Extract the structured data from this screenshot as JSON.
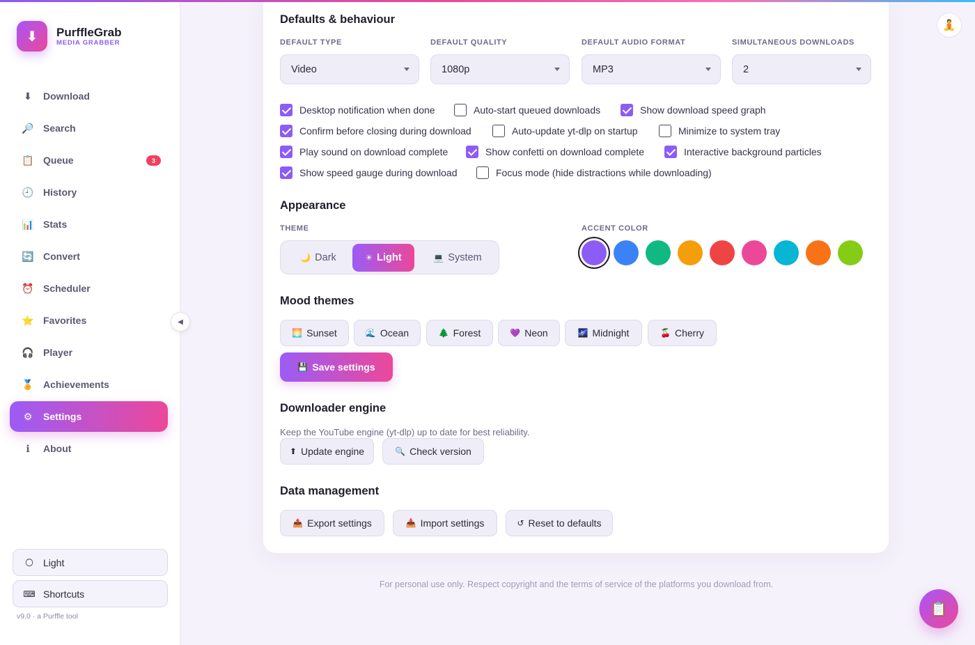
{
  "brand": {
    "name": "PurffleGrab",
    "subtitle": "MEDIA GRABBER",
    "logo_icon": "download-arrow-icon"
  },
  "nav": [
    {
      "label": "Download",
      "icon": "download-icon",
      "glyph": "⬇"
    },
    {
      "label": "Search",
      "icon": "search-icon",
      "glyph": "🔎"
    },
    {
      "label": "Queue",
      "icon": "clipboard-icon",
      "glyph": "📋",
      "badge": "3"
    },
    {
      "label": "History",
      "icon": "clock-icon",
      "glyph": "🕘"
    },
    {
      "label": "Stats",
      "icon": "chart-icon",
      "glyph": "📊"
    },
    {
      "label": "Convert",
      "icon": "convert-icon",
      "glyph": "🔄"
    },
    {
      "label": "Scheduler",
      "icon": "alarm-clock-icon",
      "glyph": "⏰"
    },
    {
      "label": "Favorites",
      "icon": "star-icon",
      "glyph": "⭐"
    },
    {
      "label": "Player",
      "icon": "headphones-icon",
      "glyph": "🎧"
    },
    {
      "label": "Achievements",
      "icon": "medal-icon",
      "glyph": "🏅"
    },
    {
      "label": "Settings",
      "icon": "gear-icon",
      "glyph": "⚙",
      "active": true
    },
    {
      "label": "About",
      "icon": "info-icon",
      "glyph": "ℹ"
    }
  ],
  "sidebar_bottom": {
    "theme_toggle": "Light",
    "shortcuts": "Shortcuts",
    "version": "v9.0 · a Purffle tool"
  },
  "defaults": {
    "title": "Defaults & behaviour",
    "fields": [
      {
        "label": "DEFAULT TYPE",
        "value": "Video"
      },
      {
        "label": "DEFAULT QUALITY",
        "value": "1080p"
      },
      {
        "label": "DEFAULT AUDIO FORMAT",
        "value": "MP3"
      },
      {
        "label": "SIMULTANEOUS DOWNLOADS",
        "value": "2"
      }
    ],
    "checkboxes": [
      {
        "label": "Desktop notification when done",
        "checked": true
      },
      {
        "label": "Auto-start queued downloads",
        "checked": false
      },
      {
        "label": "Show download speed graph",
        "checked": true
      },
      {
        "label": "Confirm before closing during download",
        "checked": true
      },
      {
        "label": "Auto-update yt-dlp on startup",
        "checked": false
      },
      {
        "label": "Minimize to system tray",
        "checked": false
      },
      {
        "label": "Play sound on download complete",
        "checked": true
      },
      {
        "label": "Show confetti on download complete",
        "checked": true
      },
      {
        "label": "Interactive background particles",
        "checked": true
      },
      {
        "label": "Show speed gauge during download",
        "checked": true
      },
      {
        "label": "Focus mode (hide distractions while downloading)",
        "checked": false
      }
    ]
  },
  "appearance": {
    "title": "Appearance",
    "theme_label": "THEME",
    "themes": [
      {
        "label": "Dark",
        "icon": "moon-icon",
        "glyph": "🌙"
      },
      {
        "label": "Light",
        "icon": "sun-icon",
        "glyph": "☀",
        "active": true
      },
      {
        "label": "System",
        "icon": "monitor-icon",
        "glyph": "💻"
      }
    ],
    "accent_label": "ACCENT COLOR",
    "accents": [
      "#8b5cf6",
      "#3b82f6",
      "#10b981",
      "#f59e0b",
      "#ef4444",
      "#ec4899",
      "#06b6d4",
      "#f97316",
      "#84cc16"
    ],
    "selected_accent": "#8b5cf6"
  },
  "moods": {
    "title": "Mood themes",
    "items": [
      {
        "label": "Sunset",
        "icon": "sunset-icon",
        "glyph": "🌅"
      },
      {
        "label": "Ocean",
        "icon": "wave-icon",
        "glyph": "🌊"
      },
      {
        "label": "Forest",
        "icon": "tree-icon",
        "glyph": "🌲"
      },
      {
        "label": "Neon",
        "icon": "purple-heart-icon",
        "glyph": "💜"
      },
      {
        "label": "Midnight",
        "icon": "night-sky-icon",
        "glyph": "🌌"
      },
      {
        "label": "Cherry",
        "icon": "cherries-icon",
        "glyph": "🍒"
      }
    ],
    "save_label": "Save settings",
    "save_glyph": "💾"
  },
  "engine": {
    "title": "Downloader engine",
    "description": "Keep the YouTube engine (yt-dlp) up to date for best reliability.",
    "update_label": "Update engine",
    "check_label": "Check version"
  },
  "data_mgmt": {
    "title": "Data management",
    "export_label": "Export settings",
    "import_label": "Import settings",
    "reset_label": "Reset to defaults"
  },
  "footer": "For personal use only. Respect copyright and the terms of service of the platforms you download from.",
  "avatar_icon": "person-meditating-icon",
  "fab_icon": "clipboard-icon"
}
